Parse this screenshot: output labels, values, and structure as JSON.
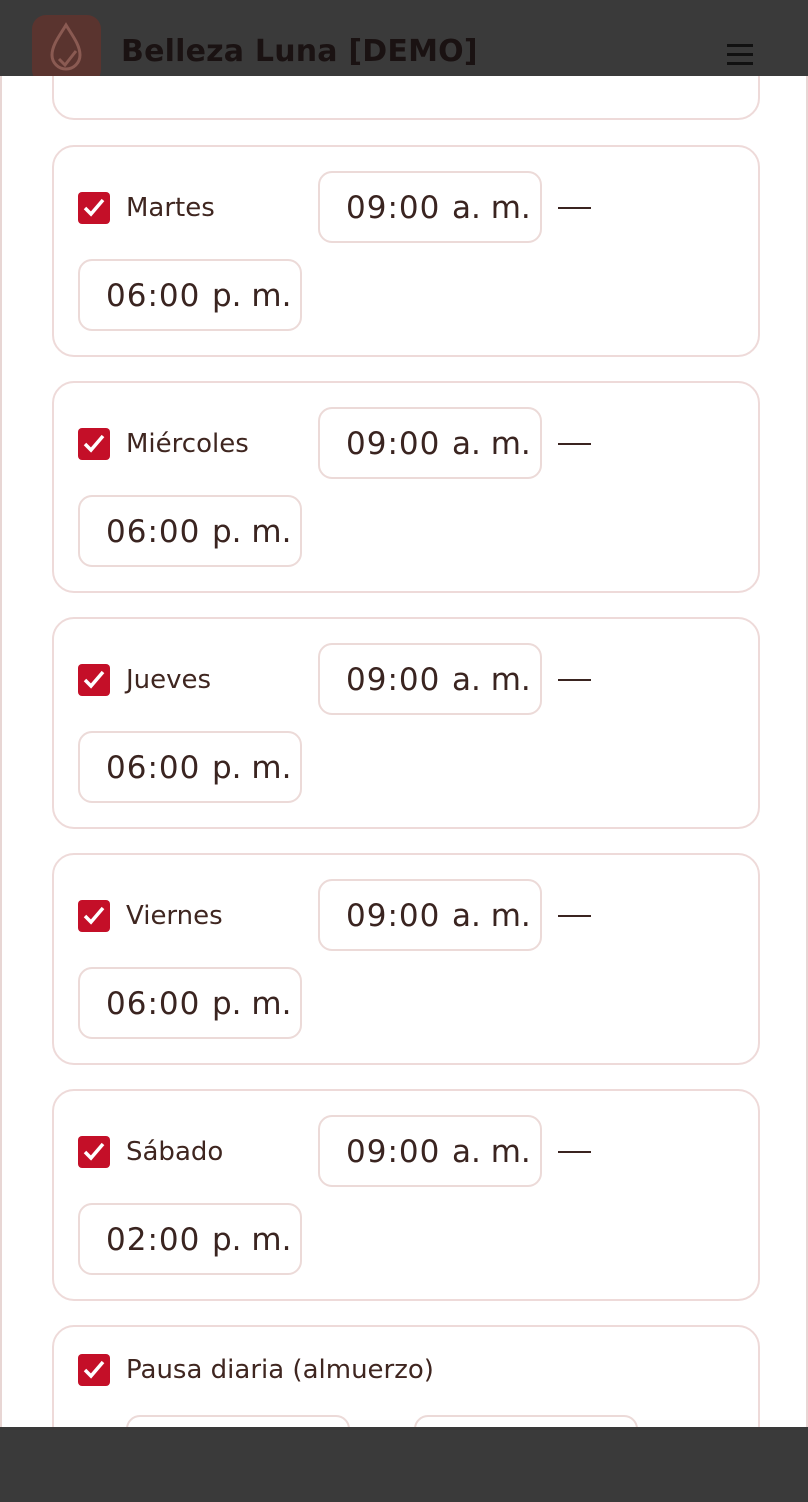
{
  "app": {
    "brand": "Belleza Luna [DEMO]"
  },
  "colors": {
    "checkbox": "#c40f28",
    "card_border": "#eedad9",
    "text": "#3f2620",
    "chrome": "#3a3a3a"
  },
  "icons": {
    "logo": "water-drop-check-icon",
    "menu": "hamburger-menu-icon",
    "checkbox": "checkmark-icon"
  },
  "schedule": {
    "monday_partial": {
      "end_time": ""
    },
    "days": [
      {
        "label": "Martes",
        "checked": true,
        "start_hh": "09:00",
        "start_ampm": "a. m.",
        "end_hh": "06:00",
        "end_ampm": "p. m."
      },
      {
        "label": "Miércoles",
        "checked": true,
        "start_hh": "09:00",
        "start_ampm": "a. m.",
        "end_hh": "06:00",
        "end_ampm": "p. m."
      },
      {
        "label": "Jueves",
        "checked": true,
        "start_hh": "09:00",
        "start_ampm": "a. m.",
        "end_hh": "06:00",
        "end_ampm": "p. m."
      },
      {
        "label": "Viernes",
        "checked": true,
        "start_hh": "09:00",
        "start_ampm": "a. m.",
        "end_hh": "06:00",
        "end_ampm": "p. m."
      },
      {
        "label": "Sábado",
        "checked": true,
        "start_hh": "09:00",
        "start_ampm": "a. m.",
        "end_hh": "02:00",
        "end_ampm": "p. m."
      }
    ],
    "break": {
      "label": "Pausa diaria (almuerzo)",
      "checked": true
    }
  }
}
